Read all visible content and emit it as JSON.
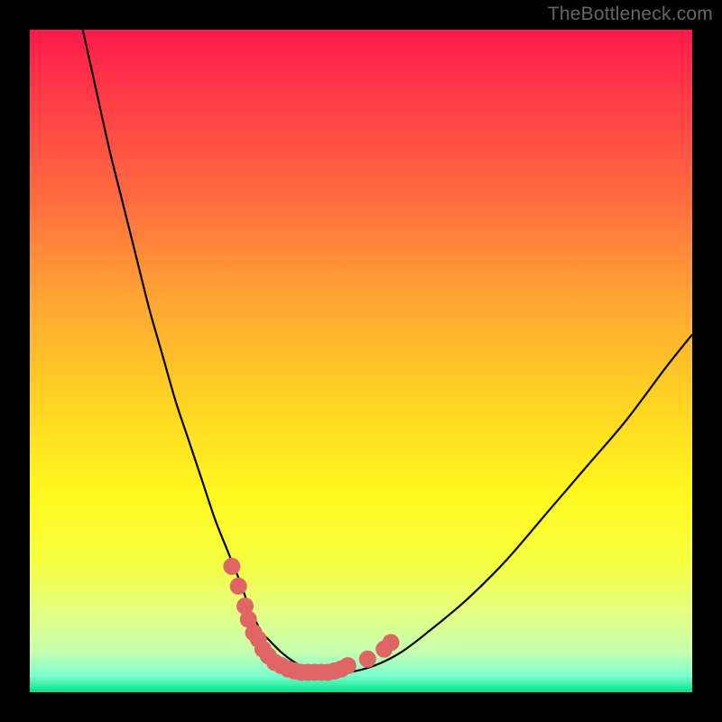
{
  "watermark": "TheBottleneck.com",
  "chart_data": {
    "type": "line",
    "title": "",
    "xlabel": "",
    "ylabel": "",
    "xlim": [
      0,
      100
    ],
    "ylim": [
      0,
      100
    ],
    "grid": false,
    "legend": false,
    "background_gradient": {
      "stops": [
        {
          "offset": 0.0,
          "color": "#ff1a4b"
        },
        {
          "offset": 0.1,
          "color": "#ff3b47"
        },
        {
          "offset": 0.25,
          "color": "#ff6a3f"
        },
        {
          "offset": 0.4,
          "color": "#ffa334"
        },
        {
          "offset": 0.55,
          "color": "#ffd023"
        },
        {
          "offset": 0.7,
          "color": "#fff81e"
        },
        {
          "offset": 0.8,
          "color": "#f6ff3e"
        },
        {
          "offset": 0.88,
          "color": "#e4ff83"
        },
        {
          "offset": 0.94,
          "color": "#c4ffb0"
        },
        {
          "offset": 0.975,
          "color": "#7dffcf"
        },
        {
          "offset": 1.0,
          "color": "#00e48a"
        }
      ]
    },
    "series": [
      {
        "name": "bottleneck-curve",
        "color": "#000000",
        "x": [
          8,
          10,
          12,
          14,
          16,
          18,
          20,
          22,
          24,
          26,
          28,
          30,
          32,
          33,
          34,
          35,
          36,
          38,
          40,
          42,
          44,
          48,
          52,
          56,
          60,
          66,
          72,
          78,
          84,
          90,
          96,
          100
        ],
        "y": [
          100,
          91,
          82,
          74,
          66,
          58,
          51,
          44,
          38,
          32,
          26,
          21,
          16,
          13,
          11,
          9,
          8,
          6,
          4.5,
          3.5,
          3,
          3,
          4,
          6,
          9,
          14,
          20,
          27,
          34,
          41,
          49,
          54
        ]
      }
    ],
    "markers": {
      "name": "bottleneck-trough-markers",
      "color": "#e06666",
      "points": [
        {
          "x": 30.5,
          "y": 19
        },
        {
          "x": 31.5,
          "y": 16
        },
        {
          "x": 32.5,
          "y": 13
        },
        {
          "x": 33.0,
          "y": 11
        },
        {
          "x": 33.8,
          "y": 9
        },
        {
          "x": 34.5,
          "y": 8
        },
        {
          "x": 35.2,
          "y": 6.5
        },
        {
          "x": 36.0,
          "y": 5.5
        },
        {
          "x": 37.0,
          "y": 4.5
        },
        {
          "x": 38.0,
          "y": 4
        },
        {
          "x": 39.0,
          "y": 3.5
        },
        {
          "x": 40.0,
          "y": 3.2
        },
        {
          "x": 41.0,
          "y": 3.0
        },
        {
          "x": 42.0,
          "y": 3.0
        },
        {
          "x": 43.0,
          "y": 3.0
        },
        {
          "x": 44.0,
          "y": 3.0
        },
        {
          "x": 45.0,
          "y": 3.0
        },
        {
          "x": 46.0,
          "y": 3.2
        },
        {
          "x": 47.0,
          "y": 3.5
        },
        {
          "x": 48.0,
          "y": 4.0
        },
        {
          "x": 51.0,
          "y": 5.0
        },
        {
          "x": 53.5,
          "y": 6.5
        },
        {
          "x": 54.5,
          "y": 7.5
        }
      ]
    }
  }
}
